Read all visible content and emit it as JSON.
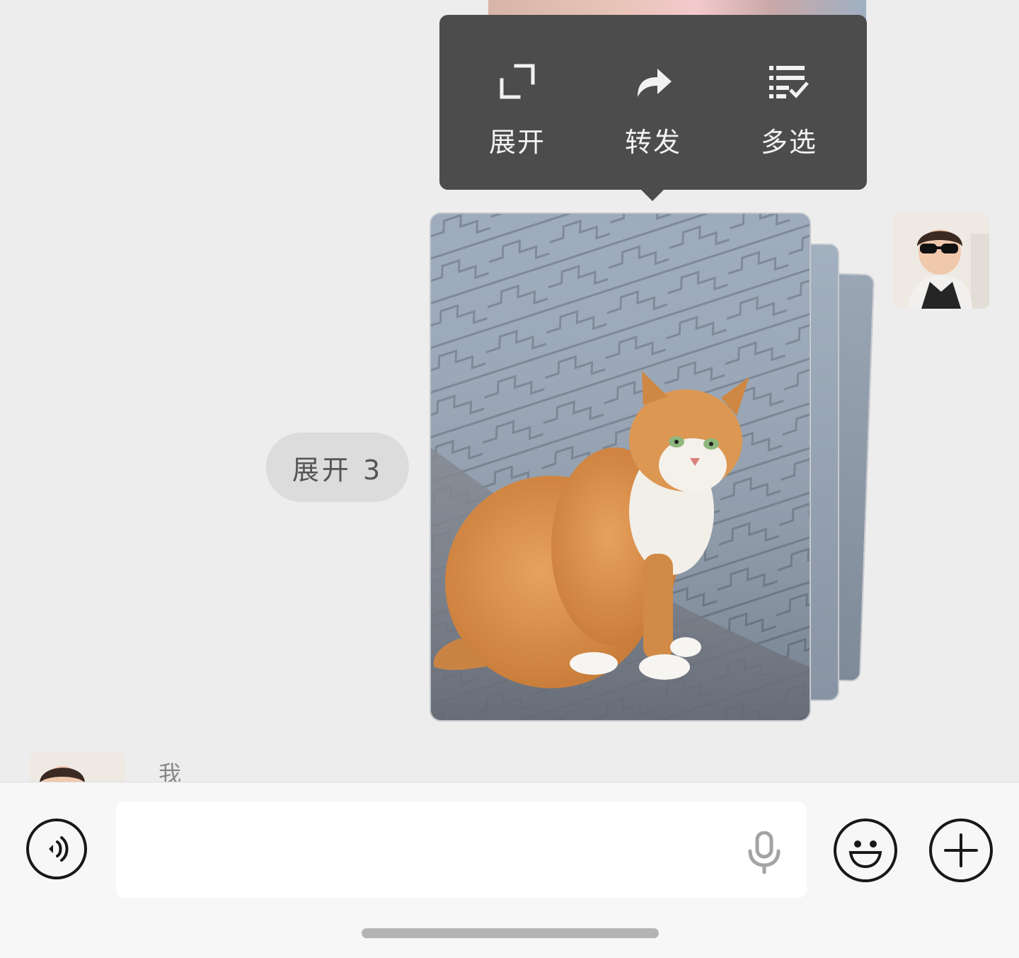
{
  "context_menu": {
    "items": [
      {
        "label": "展开",
        "icon": "expand-icon"
      },
      {
        "label": "转发",
        "icon": "forward-icon"
      },
      {
        "label": "多选",
        "icon": "multi-select-icon"
      }
    ]
  },
  "message": {
    "expand_pill_label": "展开 3",
    "image_subject": "orange-tabby-cat-on-paving-stones"
  },
  "below_message": {
    "sender_name": "我"
  },
  "input_bar": {
    "value": "",
    "voice_icon": "voice-icon",
    "mic_icon": "microphone-icon",
    "emoji_icon": "emoji-icon",
    "plus_icon": "plus-icon"
  },
  "colors": {
    "background": "#ededed",
    "menu_background": "#4c4c4c",
    "input_bar_background": "#f7f7f7"
  }
}
